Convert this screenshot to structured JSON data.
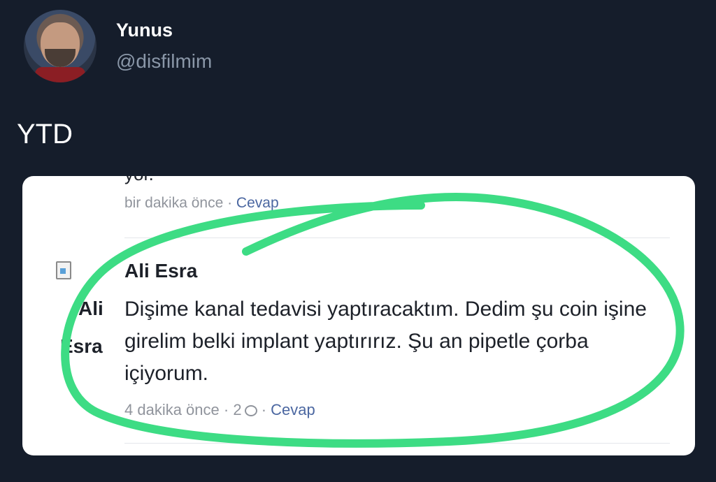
{
  "tweet": {
    "author_name": "Yunus",
    "author_handle": "@disfilmim",
    "text": "YTD"
  },
  "embedded_comment": {
    "previous_comment": {
      "partial_text": "yor.",
      "meta_time": "bir dakika önce",
      "meta_separator": " · ",
      "meta_reply": "Cevap"
    },
    "comment": {
      "avatar_alt_line1": "Ali",
      "avatar_alt_line2": "Esra",
      "author": "Ali Esra",
      "text": "Dişime kanal tedavisi yaptıracaktım. Dedim şu coin işine girelim belki implant yaptırırız. Şu an pipetle çorba içiyorum.",
      "meta_time": "4 dakika önce",
      "meta_separator": " · ",
      "reactions": "2",
      "meta_separator2": " · ",
      "meta_reply": "Cevap"
    }
  },
  "colors": {
    "background": "#151d2b",
    "card": "#ffffff",
    "highlight_circle": "#3ddc84",
    "link": "#4b67a1",
    "meta": "#90949c"
  },
  "icons": [
    "comment-bubble-icon",
    "broken-image-icon"
  ]
}
